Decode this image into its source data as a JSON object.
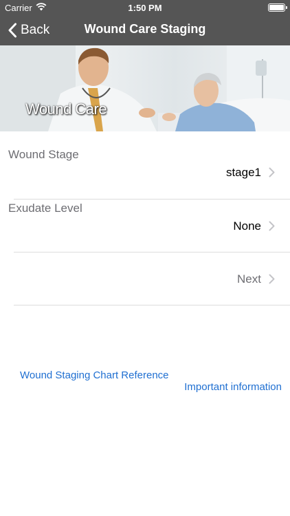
{
  "status_bar": {
    "carrier": "Carrier",
    "time": "1:50 PM"
  },
  "nav": {
    "back_label": "Back",
    "title": "Wound Care Staging"
  },
  "hero": {
    "caption": "Wound Care"
  },
  "form": {
    "wound_stage": {
      "label": "Wound Stage",
      "value": "stage1"
    },
    "exudate_level": {
      "label": "Exudate Level",
      "value": "None"
    },
    "next_label": "Next"
  },
  "links": {
    "chart_reference": "Wound Staging Chart Reference",
    "important_info": "Important information"
  },
  "colors": {
    "nav_background": "#555555",
    "link": "#1f6fd1",
    "label": "#6d6d72"
  },
  "icons": {
    "back": "chevron-left-icon",
    "disclosure": "chevron-right-icon",
    "wifi": "wifi-icon",
    "battery": "battery-icon"
  }
}
